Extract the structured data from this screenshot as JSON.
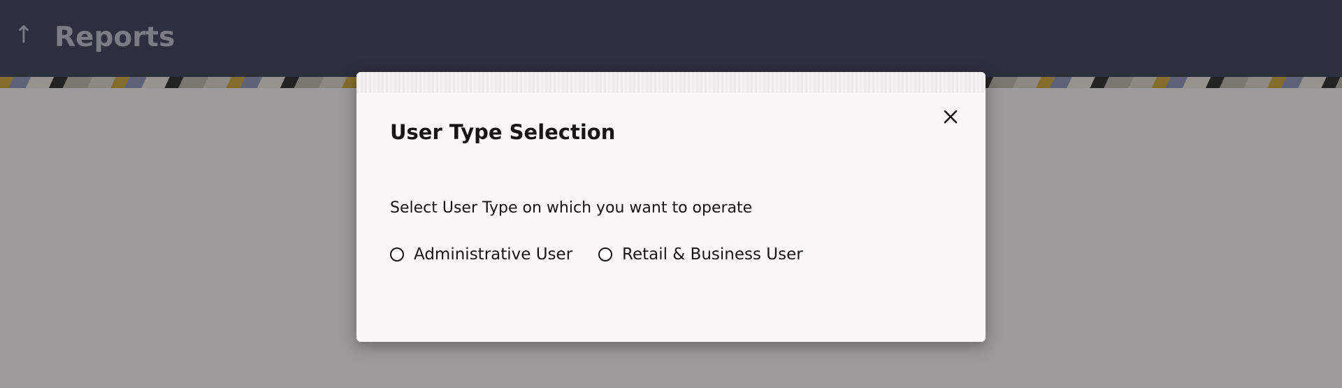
{
  "header": {
    "back_icon": "up-arrow-icon",
    "title": "Reports"
  },
  "modal": {
    "title": "User Type Selection",
    "close_icon": "close-icon",
    "description": "Select User Type on which you want to operate",
    "options": [
      {
        "label": "Administrative User",
        "selected": false
      },
      {
        "label": "Retail & Business User",
        "selected": false
      }
    ]
  },
  "colors": {
    "header_bg": "#3b3f55",
    "header_text": "#b8bccb",
    "modal_bg": "#f9f8f6",
    "text": "#161513"
  }
}
